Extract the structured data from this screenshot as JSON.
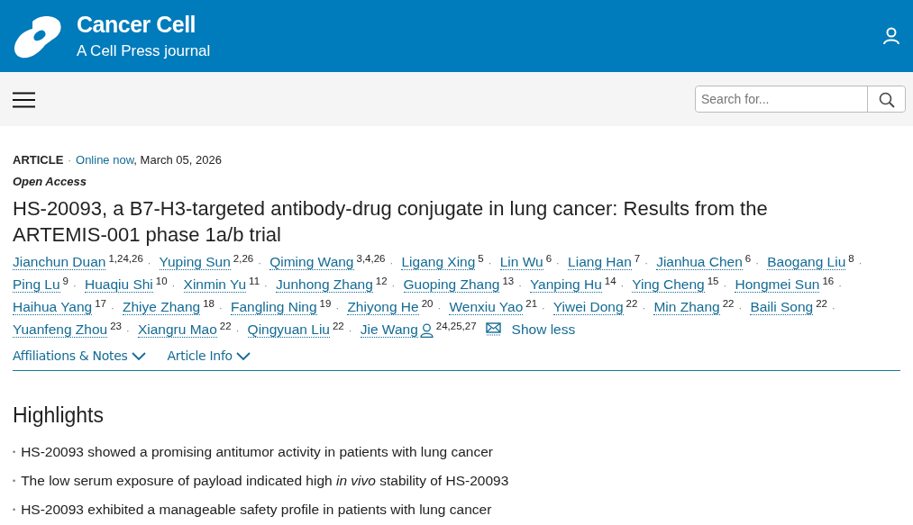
{
  "journal": {
    "name": "Cancer Cell",
    "tagline": "A Cell Press journal"
  },
  "search": {
    "placeholder": "Search for..."
  },
  "article": {
    "type": "ARTICLE",
    "separator": "·",
    "status": "Online now",
    "date": ", March 05, 2026",
    "access": "Open Access",
    "title": "HS-20093, a B7-H3-targeted antibody-drug conjugate in lung cancer: Results from the ARTEMIS-001 phase 1a/b trial"
  },
  "authors": {
    "separator": "·",
    "show_toggle": "Show less",
    "items": [
      {
        "name": "Jianchun Duan",
        "affiliations": "1,24,26",
        "corresponding": false
      },
      {
        "name": "Yuping Sun",
        "affiliations": "2,26",
        "corresponding": false
      },
      {
        "name": "Qiming Wang",
        "affiliations": "3,4,26",
        "corresponding": false
      },
      {
        "name": "Ligang Xing",
        "affiliations": "5",
        "corresponding": false
      },
      {
        "name": "Lin Wu",
        "affiliations": "6",
        "corresponding": false
      },
      {
        "name": "Liang Han",
        "affiliations": "7",
        "corresponding": false
      },
      {
        "name": "Jianhua Chen",
        "affiliations": "6",
        "corresponding": false
      },
      {
        "name": "Baogang Liu",
        "affiliations": "8",
        "corresponding": false
      },
      {
        "name": "Ping Lu",
        "affiliations": "9",
        "corresponding": false
      },
      {
        "name": "Huaqiu Shi",
        "affiliations": "10",
        "corresponding": false
      },
      {
        "name": "Xinmin Yu",
        "affiliations": "11",
        "corresponding": false
      },
      {
        "name": "Junhong Zhang",
        "affiliations": "12",
        "corresponding": false
      },
      {
        "name": "Guoping Zhang",
        "affiliations": "13",
        "corresponding": false
      },
      {
        "name": "Yanping Hu",
        "affiliations": "14",
        "corresponding": false
      },
      {
        "name": "Ying Cheng",
        "affiliations": "15",
        "corresponding": false
      },
      {
        "name": "Hongmei Sun",
        "affiliations": "16",
        "corresponding": false
      },
      {
        "name": "Haihua Yang",
        "affiliations": "17",
        "corresponding": false
      },
      {
        "name": "Zhiye Zhang",
        "affiliations": "18",
        "corresponding": false
      },
      {
        "name": "Fangling Ning",
        "affiliations": "19",
        "corresponding": false
      },
      {
        "name": "Zhiyong He",
        "affiliations": "20",
        "corresponding": false
      },
      {
        "name": "Wenxiu Yao",
        "affiliations": "21",
        "corresponding": false
      },
      {
        "name": "Yiwei Dong",
        "affiliations": "22",
        "corresponding": false
      },
      {
        "name": "Min Zhang",
        "affiliations": "22",
        "corresponding": false
      },
      {
        "name": "Baili Song",
        "affiliations": "22",
        "corresponding": false
      },
      {
        "name": "Yuanfeng Zhou",
        "affiliations": "23",
        "corresponding": false
      },
      {
        "name": "Xiangru Mao",
        "affiliations": "22",
        "corresponding": false
      },
      {
        "name": "Qingyuan Liu",
        "affiliations": "22",
        "corresponding": false
      },
      {
        "name": "Jie Wang",
        "affiliations": "24,25,27",
        "corresponding": true
      }
    ]
  },
  "info_tabs": [
    {
      "label": "Affiliations & Notes",
      "expanded": false
    },
    {
      "label": "Article Info",
      "expanded": false
    }
  ],
  "highlights": {
    "heading": "Highlights",
    "bullet": "•",
    "items": [
      "HS-20093 showed a promising antitumor activity in patients with lung cancer",
      "The low serum exposure of payload indicated high *in vivo* stability of HS-20093",
      "HS-20093 exhibited a manageable safety profile in patients with lung cancer"
    ]
  }
}
